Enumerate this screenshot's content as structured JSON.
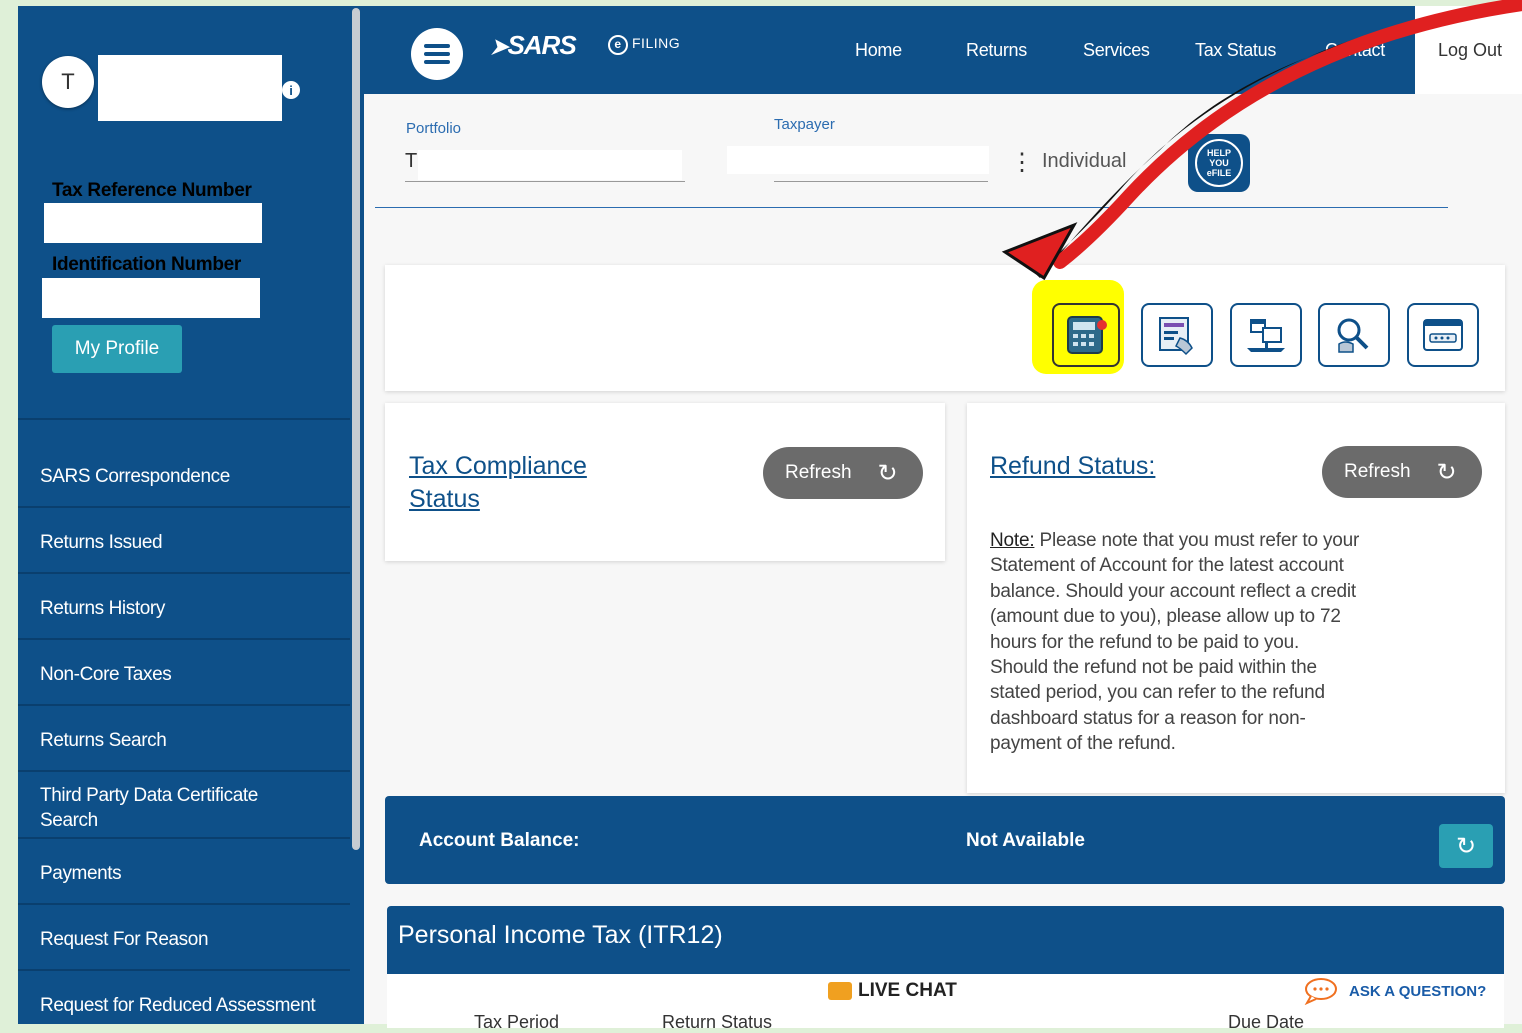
{
  "sidebar": {
    "avatar_initial": "T",
    "tax_ref_label": "Tax Reference Number",
    "id_label": "Identification Number",
    "profile_button": "My Profile",
    "items": [
      {
        "label": "SARS Correspondence"
      },
      {
        "label": "Returns Issued"
      },
      {
        "label": "Returns History"
      },
      {
        "label": "Non-Core Taxes"
      },
      {
        "label": "Returns Search"
      },
      {
        "label": "Third Party Data Certificate Search"
      },
      {
        "label": "Payments"
      },
      {
        "label": "Request For Reason"
      },
      {
        "label": "Request for Reduced Assessment"
      }
    ]
  },
  "header": {
    "logo": "SARS",
    "filing": "FILING",
    "nav": [
      "Home",
      "Returns",
      "Services",
      "Tax Status",
      "Contact"
    ],
    "logout": "Log Out"
  },
  "portfolio": {
    "portfolio_label": "Portfolio",
    "portfolio_value": "T",
    "taxpayer_label": "Taxpayer",
    "individual": "Individual",
    "help_badge": "HELP YOU eFILE"
  },
  "tools": {
    "icons": [
      "calculator-icon",
      "document-hand-icon",
      "laptop-calendar-icon",
      "magnifier-hand-icon",
      "browser-window-icon"
    ],
    "highlight_color": "#ffff00"
  },
  "compliance": {
    "title": "Tax Compliance Status",
    "refresh": "Refresh"
  },
  "refund": {
    "title": "Refund Status:",
    "refresh": "Refresh",
    "note_label": "Note:",
    "note_text": "Please note that you must refer to your Statement of Account for the latest account balance. Should your account reflect a credit (amount due to you), please allow up to 72 hours for the refund to be paid to you. Should the refund not be paid within the stated period, you can refer to the refund dashboard status for a reason for non-payment of the refund."
  },
  "account": {
    "label": "Account Balance:",
    "value": "Not Available"
  },
  "pit": {
    "title": "Personal Income Tax (ITR12)",
    "columns": [
      "Tax Period",
      "Return Status",
      "Due Date"
    ],
    "live_chat": "LIVE CHAT",
    "ask": "ASK A QUESTION?"
  },
  "colors": {
    "brand": "#0e5089",
    "accent": "#2a9fb3",
    "annotation_arrow": "#e02020"
  }
}
